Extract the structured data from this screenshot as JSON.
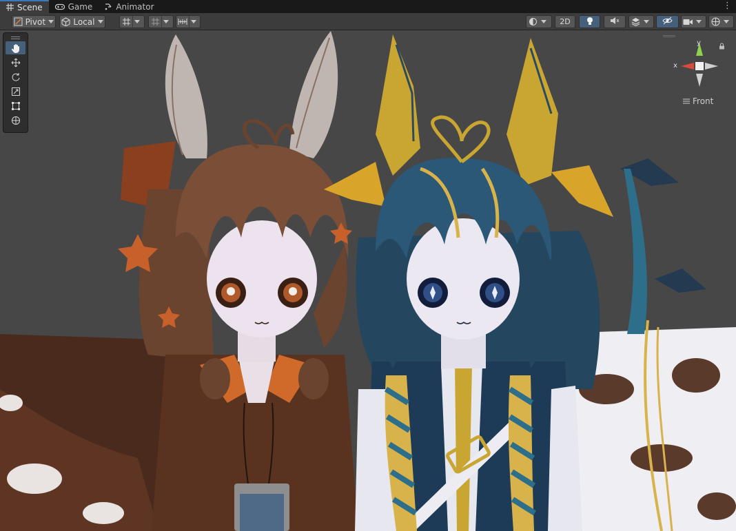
{
  "tabs": [
    {
      "label": "Scene",
      "icon": "grid-icon",
      "active": true
    },
    {
      "label": "Game",
      "icon": "gamepad-icon",
      "active": false
    },
    {
      "label": "Animator",
      "icon": "animator-icon",
      "active": false
    }
  ],
  "toolbar": {
    "pivot_label": "Pivot",
    "local_label": "Local",
    "mode_2d_label": "2D"
  },
  "tools": [
    "hand-tool-icon",
    "move-tool-icon",
    "rotate-tool-icon",
    "scale-tool-icon",
    "rect-tool-icon",
    "transform-tool-icon"
  ],
  "gizmo": {
    "y_label": "y",
    "x_label": "x",
    "view_label": "Front"
  },
  "colors": {
    "background": "#474747",
    "toolbar": "#3c3c3c",
    "tabbar": "#191919",
    "accent": "#46607c",
    "x_axis": "#d94a3a",
    "y_axis": "#8fd14f"
  }
}
